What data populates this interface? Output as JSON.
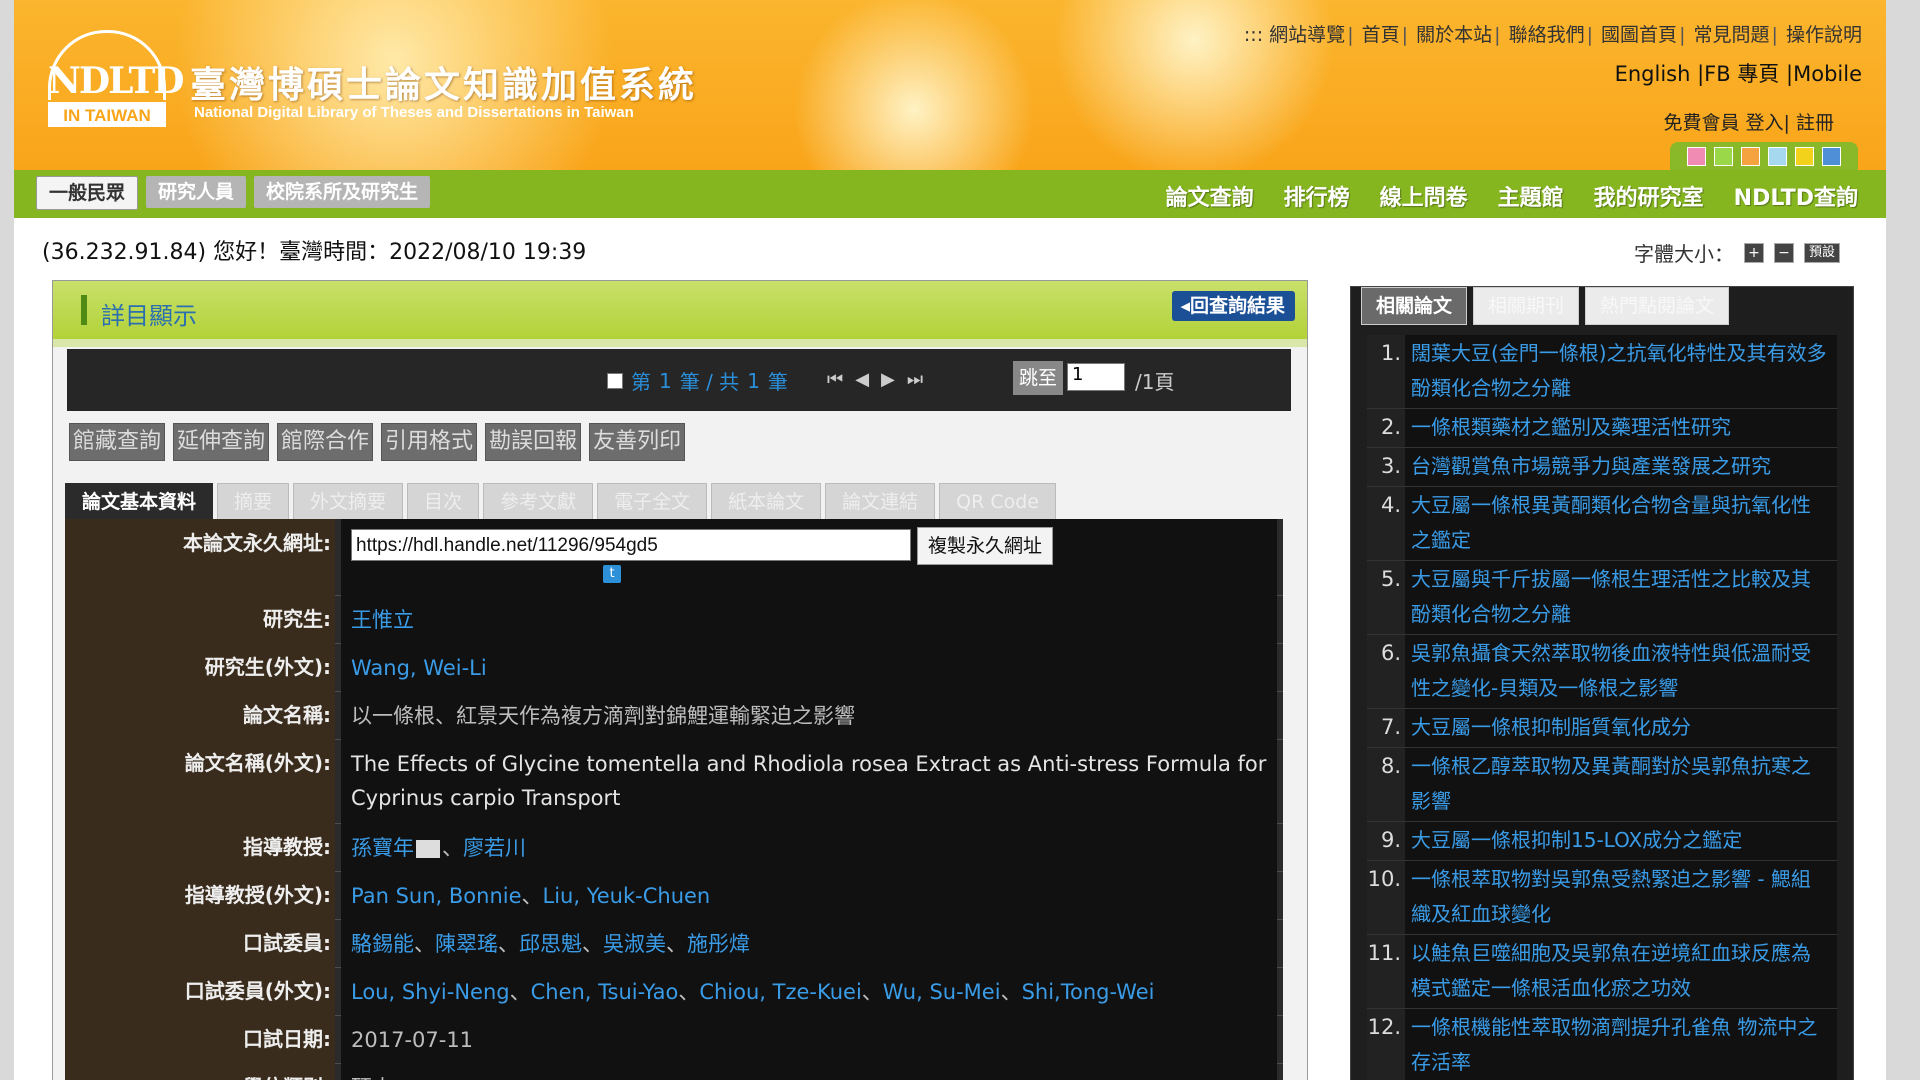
{
  "header": {
    "logo_text": "NDLTD",
    "logo_sub": "IN TAIWAN",
    "site_title": "臺灣博碩士論文知識加值系統",
    "site_subtitle": "National Digital Library of Theses and Dissertations in Taiwan",
    "top_links": [
      ":::",
      "網站導覽",
      "首頁",
      "關於本站",
      "聯絡我們",
      "國圖首頁",
      "常見問題",
      "操作說明"
    ],
    "lang_links": [
      "English",
      "FB 專頁",
      "Mobile"
    ],
    "member_links": [
      "免費會員",
      "登入",
      "註冊"
    ],
    "swatch_colors": [
      "#f08cb4",
      "#9ad84a",
      "#f5a341",
      "#a6d8f0",
      "#f2d21a",
      "#4f8fd8"
    ]
  },
  "nav": {
    "role_tabs": [
      "一般民眾",
      "研究人員",
      "校院系所及研究生"
    ],
    "main_links": [
      "論文查詢",
      "排行榜",
      "線上問卷",
      "主題館",
      "我的研究室",
      "NDLTD查詢"
    ]
  },
  "status": {
    "greeting": "(36.232.91.84) 您好！臺灣時間：2022/08/10 19:39",
    "font_size_label": "字體大小：",
    "font_plus": "+",
    "font_minus": "−",
    "font_default": "預設"
  },
  "detail_panel": {
    "title": "詳目顯示",
    "back_button": "回查詢結果",
    "pager": {
      "text_pre": "第",
      "current": "1",
      "text_mid": "筆 / 共",
      "total": "1",
      "text_post": "筆",
      "jump_label": "跳至",
      "jump_value": "1",
      "page_total": "/1頁"
    },
    "function_buttons": [
      "館藏查詢",
      "延伸查詢",
      "館際合作",
      "引用格式",
      "勘誤回報",
      "友善列印"
    ],
    "tabs": [
      "論文基本資料",
      "摘要",
      "外文摘要",
      "目次",
      "參考文獻",
      "電子全文",
      "紙本論文",
      "論文連結",
      "QR Code"
    ],
    "fields": {
      "permalink_label": "本論文永久網址:",
      "permalink_value": "https://hdl.handle.net/11296/954gd5",
      "copy_button": "複製永久網址",
      "researcher_label": "研究生:",
      "researcher_value": "王惟立",
      "researcher_en_label": "研究生(外文):",
      "researcher_en_value": "Wang, Wei-Li",
      "title_label": "論文名稱:",
      "title_value": "以一條根、紅景天作為複方滴劑對錦鯉運輸緊迫之影響",
      "title_en_label": "論文名稱(外文):",
      "title_en_value": "The Effects of Glycine tomentella and Rhodiola rosea Extract as Anti-stress Formula for Cyprinus carpio Transport",
      "advisor_label": "指導教授:",
      "advisors": [
        "孫寶年",
        "廖若川"
      ],
      "advisor_en_label": "指導教授(外文):",
      "advisors_en": [
        "Pan Sun, Bonnie",
        "Liu, Yeuk-Chuen"
      ],
      "committee_label": "口試委員:",
      "committee": [
        "駱錫能",
        "陳翠瑤",
        "邱思魁",
        "吳淑美",
        "施彤煒"
      ],
      "committee_en_label": "口試委員(外文):",
      "committee_en": [
        "Lou, Shyi-Neng",
        "Chen, Tsui-Yao",
        "Chiou, Tze-Kuei",
        "Wu, Su-Mei",
        "Shi,Tong-Wei"
      ],
      "date_label": "口試日期:",
      "date_value": "2017-07-11",
      "degree_label": "學位類別:",
      "degree_value": "碩士"
    }
  },
  "sidebar": {
    "tabs": [
      "相關論文",
      "相關期刊",
      "熱門點閱論文"
    ],
    "items": [
      {
        "num": "1.",
        "title": "闊葉大豆(金門一條根)之抗氧化特性及其有效多酚類化合物之分離"
      },
      {
        "num": "2.",
        "title": "一條根類藥材之鑑別及藥理活性研究"
      },
      {
        "num": "3.",
        "title": "台灣觀賞魚市場競爭力與產業發展之研究"
      },
      {
        "num": "4.",
        "title": "大豆屬一條根異黃酮類化合物含量與抗氧化性之鑑定"
      },
      {
        "num": "5.",
        "title": "大豆屬與千斤拔屬一條根生理活性之比較及其酚類化合物之分離"
      },
      {
        "num": "6.",
        "title": "吳郭魚攝食天然萃取物後血液特性與低溫耐受性之變化-貝類及一條根之影響"
      },
      {
        "num": "7.",
        "title": "大豆屬一條根抑制脂質氧化成分"
      },
      {
        "num": "8.",
        "title": "一條根乙醇萃取物及異黃酮對於吳郭魚抗寒之影響"
      },
      {
        "num": "9.",
        "title": "大豆屬一條根抑制15-LOX成分之鑑定"
      },
      {
        "num": "10.",
        "title": "一條根萃取物對吳郭魚受熱緊迫之影響 - 鰓組織及紅血球變化"
      },
      {
        "num": "11.",
        "title": "以鮭魚巨噬細胞及吳郭魚在逆境紅血球反應為模式鑑定一條根活血化瘀之功效"
      },
      {
        "num": "12.",
        "title": "一條根機能性萃取物滴劑提升孔雀魚 物流中之存活率"
      }
    ]
  }
}
